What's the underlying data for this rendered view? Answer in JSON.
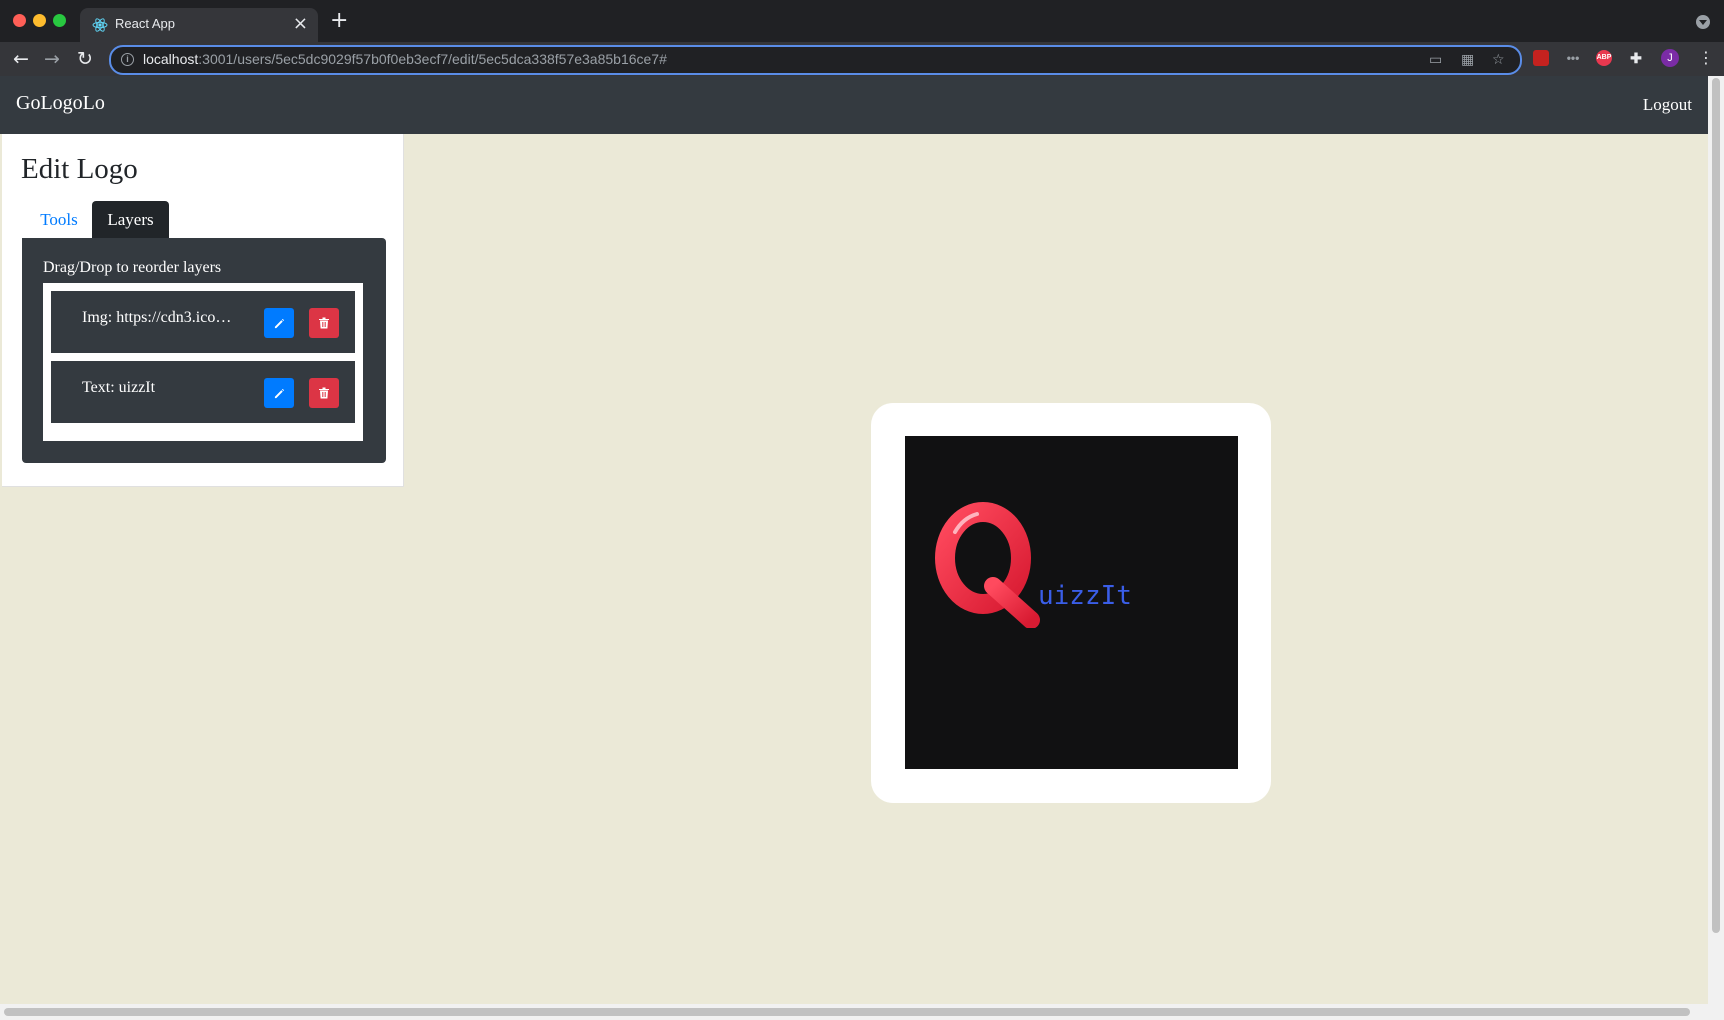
{
  "browser": {
    "tab_title": "React App",
    "url_host": "localhost",
    "url_path": ":3001/users/5ec5dc9029f57b0f0eb3ecf7/edit/5ec5dca338f57e3a85b16ce7#",
    "profile_initial": "J",
    "abp_label": "ABP"
  },
  "navbar": {
    "brand": "GoLogoLo",
    "logout": "Logout"
  },
  "panel": {
    "title": "Edit Logo",
    "tabs": [
      "Tools",
      "Layers"
    ],
    "active_tab": "Layers",
    "layers_caption": "Drag/Drop to reorder layers",
    "layers": [
      {
        "label": "Img: https://cdn3.ico…",
        "edit_icon": "pencil-icon",
        "delete_icon": "trash-icon"
      },
      {
        "label": "Text: uizzIt",
        "edit_icon": "pencil-icon",
        "delete_icon": "trash-icon"
      }
    ]
  },
  "logo": {
    "text": "uizzIt",
    "text_color": "#3a5ee8",
    "background_color": "#111112",
    "border_color": "#ffffff",
    "image_icon": "red-letter-q-icon"
  },
  "colors": {
    "primary": "#007bff",
    "danger": "#dc3545",
    "dark": "#343a40",
    "page_background": "#ebe9d7"
  }
}
